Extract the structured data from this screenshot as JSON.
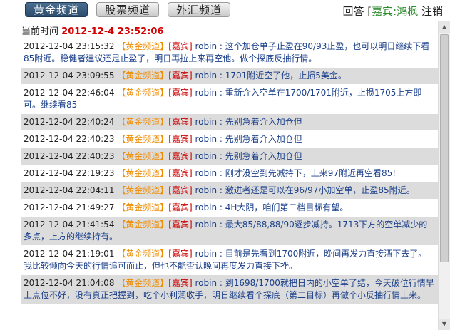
{
  "tabs": [
    {
      "label": "黄金频道"
    },
    {
      "label": "股票频道"
    },
    {
      "label": "外汇频道"
    }
  ],
  "header_right": {
    "reply": "回答",
    "guest_open": "[",
    "guest_label": "嘉宾:",
    "guest_name": "鸿枫",
    "logout": "注销"
  },
  "current_time": {
    "label": "当前时间",
    "value": "2012-12-4 23:52:06"
  },
  "messages": [
    {
      "ts": "2012-12-04 23:15:32",
      "channel": "【黄金频道】",
      "role": "[嘉宾]",
      "author": "robin",
      "sep": " : ",
      "text": "这个加仓单子止盈在90/93止盈，也可以明日继续下看85附近。稳健者建议还是止盈了，明日再拉上来再空他。做个探底反抽行情。"
    },
    {
      "ts": "2012-12-04 23:09:55",
      "channel": "【黄金频道】",
      "role": "[嘉宾]",
      "author": "robin",
      "sep": " : ",
      "text": "1701附近空了他，止损5美金。"
    },
    {
      "ts": "2012-12-04 22:46:04",
      "channel": "【黄金频道】",
      "role": "[嘉宾]",
      "author": "robin",
      "sep": " : ",
      "text": "重新介入空单在1700/1701附近，止损1705上方即可。继续看85"
    },
    {
      "ts": "2012-12-04 22:40:24",
      "channel": "【黄金频道】",
      "role": "[嘉宾]",
      "author": "robin",
      "sep": " : ",
      "text": "先别急着介入加仓但"
    },
    {
      "ts": "2012-12-04 22:40:23",
      "channel": "【黄金频道】",
      "role": "[嘉宾]",
      "author": "robin",
      "sep": " : ",
      "text": "先别急着介入加仓但"
    },
    {
      "ts": "2012-12-04 22:40:23",
      "channel": "【黄金频道】",
      "role": "[嘉宾]",
      "author": "robin",
      "sep": " : ",
      "text": "先别急着介入加仓但"
    },
    {
      "ts": "2012-12-04 22:19:23",
      "channel": "【黄金频道】",
      "role": "[嘉宾]",
      "author": "robin",
      "sep": " : ",
      "text": "刚才没空到先减持下，上来97附近再空看85!"
    },
    {
      "ts": "2012-12-04 22:04:11",
      "channel": "【黄金频道】",
      "role": "[嘉宾]",
      "author": "robin",
      "sep": " : ",
      "text": "激进者还是可以在96/97小加空单，止盈85附近。"
    },
    {
      "ts": "2012-12-04 21:49:27",
      "channel": "【黄金频道】",
      "role": "[嘉宾]",
      "author": "robin",
      "sep": " : ",
      "text": "4H大阴，咱们第二档目标有望。"
    },
    {
      "ts": "2012-12-04 21:41:54",
      "channel": "【黄金频道】",
      "role": "[嘉宾]",
      "author": "robin",
      "sep": " : ",
      "text": "最大85/88,88/90逐步减持。1713下方的空单减少的多点，上方的继续持有。"
    },
    {
      "ts": "2012-12-04 21:19:01",
      "channel": "【黄金频道】",
      "role": "[嘉宾]",
      "author": "robin",
      "sep": " : ",
      "text": "目前是先看到1700附近，晚间再发力直接酒下去了。我比较倾向今天的行情追可而止，但也不能否认晚间再度发力直接下挫。"
    },
    {
      "ts": "2012-12-04 21:04:08",
      "channel": "【黄金频道】",
      "role": "[嘉宾]",
      "author": "robin",
      "sep": " : ",
      "text": "到1698/1700就把日内的小空单了结，今天破位行情早上点位不好，没有真正把握到，吃个小利润收手，明日继续看个探底（第二目标）再做个小反抽行情上来。"
    }
  ],
  "icons": {
    "scroll_up": "triangle-up-icon",
    "scroll_down": "triangle-down-icon"
  }
}
